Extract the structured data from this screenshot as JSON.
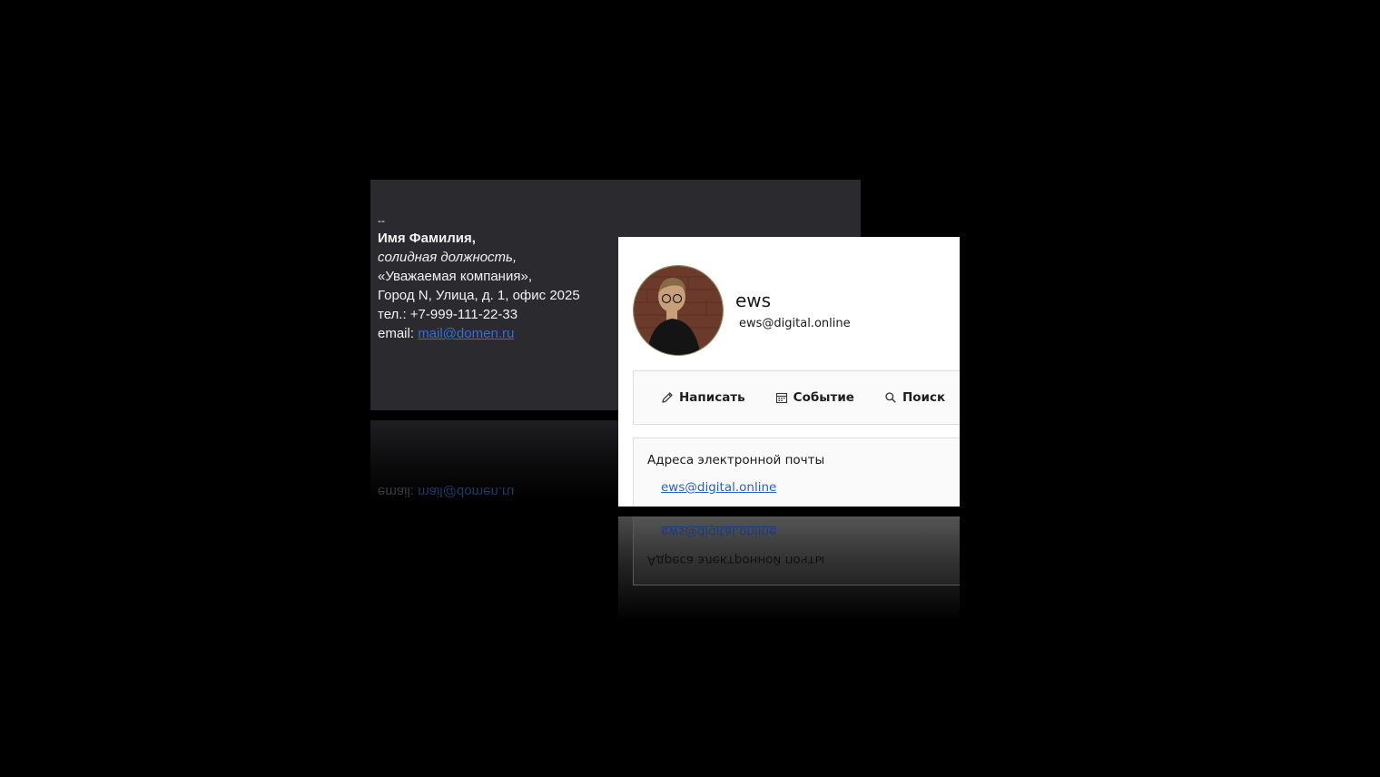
{
  "signature": {
    "dash": "--",
    "name": "Имя Фамилия,",
    "position": "солидная должность,",
    "company": "«Уважаемая компания»,",
    "address": "Город N, Улица, д. 1, офис 2025",
    "phone": "тел.: +7-999-111-22-33",
    "email_label": "email: ",
    "email_link": "mail@domen.ru",
    "link_color": "#2f6fd6"
  },
  "contact": {
    "name": "ews",
    "email": "ews@digital.online",
    "avatar_icon": "person-photo-avatar",
    "actions": [
      {
        "label": "Написать",
        "icon": "pencil-icon"
      },
      {
        "label": "Событие",
        "icon": "calendar-icon"
      },
      {
        "label": "Поиск",
        "icon": "search-icon"
      }
    ],
    "emails_section": {
      "title": "Адреса электронной почты",
      "items": [
        "ews@digital.online"
      ]
    },
    "link_color": "#2a62c8"
  }
}
